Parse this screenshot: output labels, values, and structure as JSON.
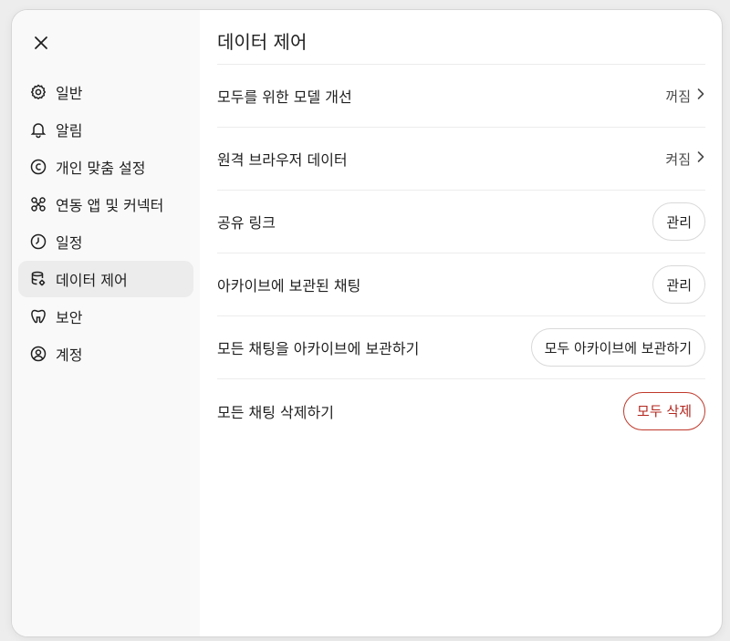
{
  "sidebar": {
    "close_icon": "close-icon",
    "items": [
      {
        "label": "일반",
        "icon": "gear-icon"
      },
      {
        "label": "알림",
        "icon": "bell-icon"
      },
      {
        "label": "개인 맞춤 설정",
        "icon": "personalization-icon"
      },
      {
        "label": "연동 앱 및 커넥터",
        "icon": "apps-icon"
      },
      {
        "label": "일정",
        "icon": "clock-icon"
      },
      {
        "label": "데이터 제어",
        "icon": "database-gear-icon",
        "active": true
      },
      {
        "label": "보안",
        "icon": "shield-icon"
      },
      {
        "label": "계정",
        "icon": "user-circle-icon"
      }
    ]
  },
  "main": {
    "title": "데이터 제어",
    "rows": [
      {
        "label": "모두를 위한 모델 개선",
        "value": "꺼짐"
      },
      {
        "label": "원격 브라우저 데이터",
        "value": "켜짐"
      },
      {
        "label": "공유 링크",
        "button": "관리"
      },
      {
        "label": "아카이브에 보관된 채팅",
        "button": "관리"
      },
      {
        "label": "모든 채팅을 아카이브에 보관하기",
        "button": "모두 아카이브에 보관하기"
      },
      {
        "label": "모든 채팅 삭제하기",
        "button": "모두 삭제"
      }
    ]
  },
  "colors": {
    "danger": "#b3261e",
    "active_bg": "#ececec",
    "sidebar_bg": "#f9f9f9"
  }
}
